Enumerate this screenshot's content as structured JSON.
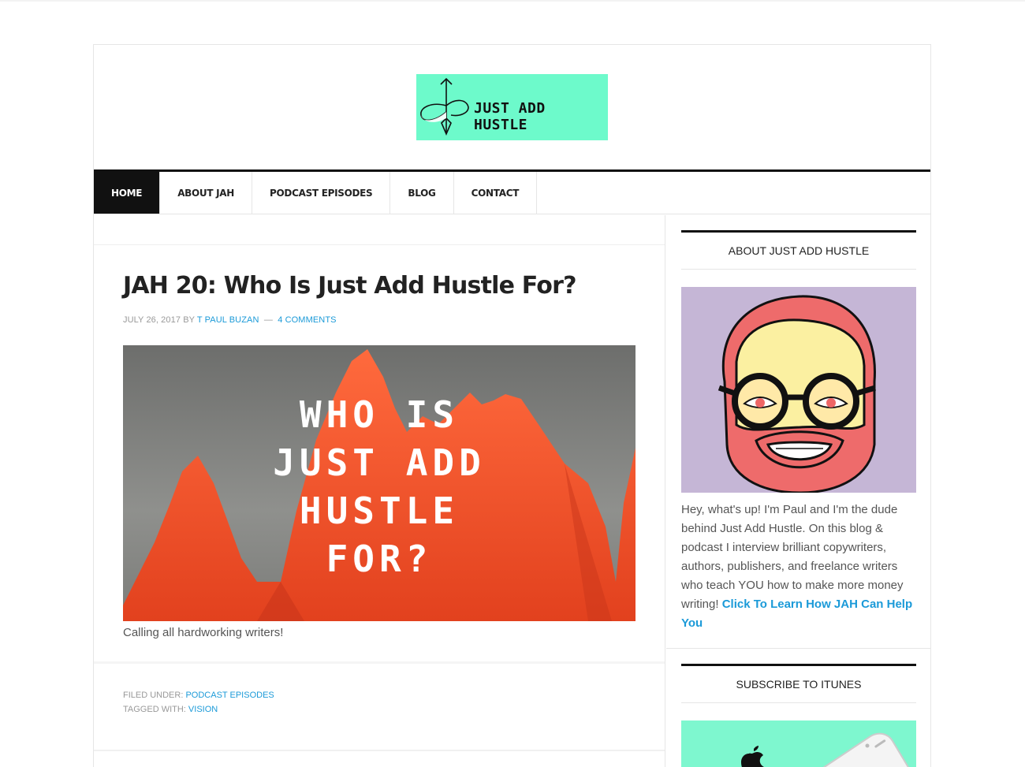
{
  "site": {
    "logo_text": "JUST ADD HUSTLE",
    "brand_color": "#6dfacb",
    "accent_link_color": "#1b9ad8"
  },
  "nav": {
    "items": [
      {
        "label": "HOME",
        "active": true
      },
      {
        "label": "ABOUT JAH",
        "active": false
      },
      {
        "label": "PODCAST EPISODES",
        "active": false
      },
      {
        "label": "BLOG",
        "active": false
      },
      {
        "label": "CONTACT",
        "active": false
      }
    ]
  },
  "post": {
    "title": "JAH 20: Who Is Just Add Hustle For?",
    "date": "JULY 26, 2017",
    "by": "BY",
    "author": "T PAUL BUZAN",
    "dash": "—",
    "comments": "4 COMMENTS",
    "image_text": "WHO IS\nJUST ADD\nHUSTLE\nFOR?",
    "caption": "Calling all hardworking writers!",
    "filed_under_label": "FILED UNDER:",
    "filed_under": "PODCAST EPISODES",
    "tagged_with_label": "TAGGED WITH:",
    "tagged_with": "VISION"
  },
  "sidebar": {
    "about_title": "ABOUT JUST ADD HUSTLE",
    "about_text": "Hey, what's up! I'm Paul and I'm the dude behind Just Add Hustle. On this blog & podcast I interview brilliant copywriters, authors, publishers, and freelance writers who teach YOU how to make more money writing!",
    "about_link": "Click To Learn How JAH Can Help You",
    "subscribe_title": "SUBSCRIBE TO ITUNES"
  }
}
